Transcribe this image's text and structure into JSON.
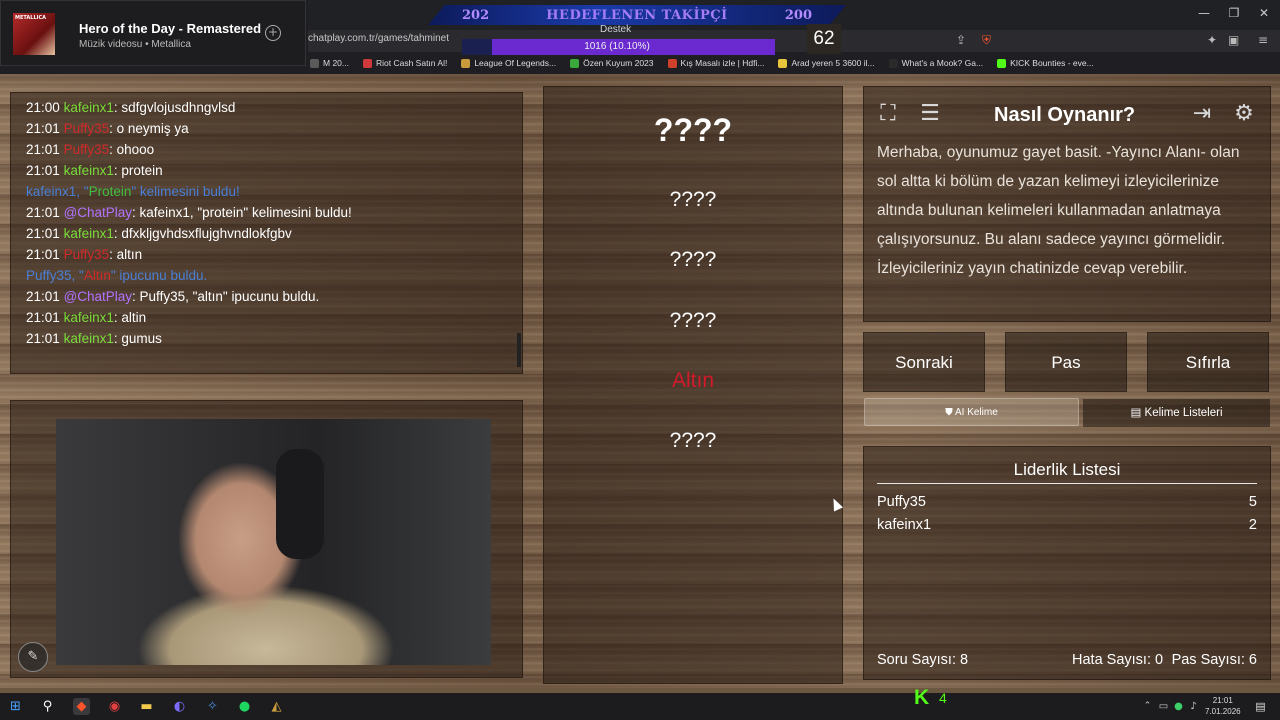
{
  "media": {
    "title": "Hero of the Day - Remastered",
    "subtitle": "Müzik videosu • Metallica"
  },
  "browser": {
    "goal_left": "202",
    "goal_title": "HEDEFLENEN TAKİPÇİ",
    "goal_right": "200",
    "url": "chatplay.com.tr/games/tahminet",
    "support_label": "Destek",
    "support_text": "1016 (10.10%)",
    "support_percent": 10.1,
    "bookmarks": [
      {
        "label": "M 20...",
        "color": "#5a5a5a"
      },
      {
        "label": "Riot Cash Satın Al!",
        "color": "#d13a3a"
      },
      {
        "label": "League Of Legends...",
        "color": "#c89b3c"
      },
      {
        "label": "Özen Kuyum 2023",
        "color": "#3aa83a"
      },
      {
        "label": "Kış Masalı izle | Hdfi...",
        "color": "#d0402a"
      },
      {
        "label": "Arad yeren 5 3600 il...",
        "color": "#e8c53a"
      },
      {
        "label": "What's a Mook? Ga...",
        "color": "#2a2a2a"
      },
      {
        "label": "KICK Bounties - eve...",
        "color": "#53fc18"
      }
    ]
  },
  "chat": {
    "lines": [
      {
        "time": "21:00",
        "user": "kafeinx1",
        "user_color": "green",
        "text": ": sdfgvlojusdhngvlsd"
      },
      {
        "time": "21:01",
        "user": "Puffy35",
        "user_color": "red",
        "text": ": o neymiş ya"
      },
      {
        "time": "21:01",
        "user": "Puffy35",
        "user_color": "red",
        "text": ": ohooo"
      },
      {
        "time": "21:01",
        "user": "kafeinx1",
        "user_color": "green",
        "text": ": protein"
      },
      {
        "system": true,
        "pre": "kafeinx1, \"",
        "kw": "Protein",
        "kw_color": "green",
        "post": "\" kelimesini buldu!"
      },
      {
        "time": "21:01",
        "user": "@ChatPlay",
        "user_color": "purple",
        "text": ": kafeinx1, \"protein\" kelimesini buldu!"
      },
      {
        "time": "21:01",
        "user": "kafeinx1",
        "user_color": "green",
        "text": ": dfxkljgvhdsxflujghvndlokfgbv"
      },
      {
        "time": "21:01",
        "user": "Puffy35",
        "user_color": "red",
        "text": ": altın"
      },
      {
        "system": true,
        "pre": "Puffy35, \"",
        "kw": "Altın",
        "kw_color": "red",
        "post": "\" ipucunu buldu."
      },
      {
        "time": "21:01",
        "user": "@ChatPlay",
        "user_color": "purple",
        "text": ": Puffy35, \"altın\" ipucunu buldu."
      },
      {
        "time": "21:01",
        "user": "kafeinx1",
        "user_color": "green",
        "text": ": altin"
      },
      {
        "time": "21:01",
        "user": "kafeinx1",
        "user_color": "green",
        "text": ": gumus"
      }
    ]
  },
  "game": {
    "timer": "62",
    "main_word": "????",
    "hints": [
      "????",
      "????",
      "????",
      "Altın",
      "????"
    ],
    "found_index": 3
  },
  "help": {
    "title": "Nasıl Oynanır?",
    "body": "Merhaba, oyunumuz gayet basit. -Yayıncı Alanı- olan sol altta ki bölüm de yazan kelimeyi izleyicilerinize altında bulunan kelimeleri kullanmadan anlatmaya çalışıyorsunuz. Bu alanı sadece yayıncı görmelidir. İzleyicileriniz yayın chatinizde cevap verebilir."
  },
  "actions": {
    "next": "Sonraki",
    "pass": "Pas",
    "reset": "Sıfırla",
    "ai_word": "AI Kelime",
    "word_lists": "Kelime Listeleri"
  },
  "leaderboard": {
    "title": "Liderlik Listesi",
    "rows": [
      {
        "name": "Puffy35",
        "score": "5"
      },
      {
        "name": "kafeinx1",
        "score": "2"
      }
    ]
  },
  "stats": {
    "questions": "Soru Sayısı: 8",
    "errors": "Hata Sayısı: 0",
    "passes": "Pas Sayısı: 6"
  },
  "taskbar": {
    "kick_count": "4",
    "time": "21:01",
    "date": "7.01.2026"
  },
  "colors": {
    "user_green": "#7bdc3a",
    "user_red": "#d12a2a",
    "user_purple": "#b272ff",
    "system_blue": "#4a7fd6",
    "kick_green": "#53fc18",
    "support_purple": "#6a2ad0"
  },
  "icons": {
    "fullscreen": "expand-icon",
    "notes": "notes-icon",
    "exit": "exit-icon",
    "settings": "gear-icon",
    "pencil": "pencil-icon"
  }
}
